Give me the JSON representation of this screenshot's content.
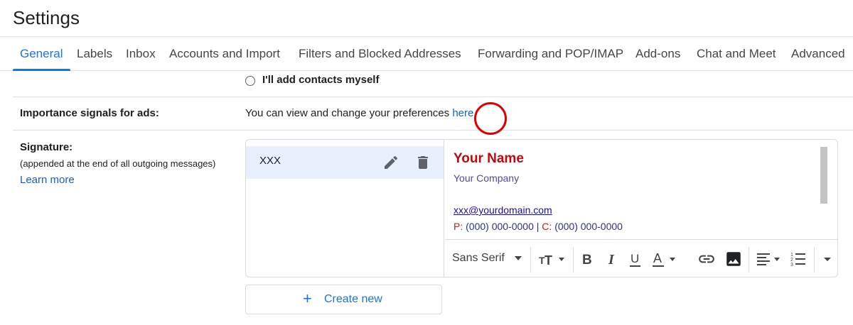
{
  "header": {
    "title": "Settings"
  },
  "tabs": [
    {
      "label": "General",
      "active": true
    },
    {
      "label": "Labels"
    },
    {
      "label": "Inbox"
    },
    {
      "label": "Accounts and Import"
    },
    {
      "label": "Filters and Blocked Addresses"
    },
    {
      "label": "Forwarding and POP/IMAP"
    },
    {
      "label": "Add-ons"
    },
    {
      "label": "Chat and Meet"
    },
    {
      "label": "Advanced"
    }
  ],
  "contacts": {
    "option_label": "I'll add contacts myself",
    "selected": false
  },
  "ads": {
    "label": "Importance signals for ads:",
    "text": "You can view and change your preferences ",
    "link": "here",
    "suffix": "."
  },
  "signature": {
    "label": "Signature:",
    "sublabel": "(appended at the end of all outgoing messages)",
    "learn_more": "Learn more",
    "items": [
      {
        "name": "XXX",
        "selected": true
      }
    ],
    "editor": {
      "name": "Your Name",
      "company": "Your Company",
      "email": "xxx@yourdomain.com",
      "phone_p_label": "P:",
      "phone_p": "(000) 000-0000",
      "phone_sep": "|",
      "phone_c_label": "C:",
      "phone_c": "(000) 000-0000"
    },
    "toolbar": {
      "font": "Sans Serif",
      "icons": [
        "text-size-icon",
        "bold-icon",
        "italic-icon",
        "underline-icon",
        "text-color-icon",
        "link-icon",
        "insert-image-icon",
        "align-icon",
        "numbered-list-icon",
        "more-formatting-icon"
      ],
      "highlighted": "insert-image-icon"
    },
    "create_new": "Create new"
  },
  "colors": {
    "accent": "#1a73e8",
    "link": "#1a5fd0",
    "highlight_ring": "#e00000",
    "sig_name": "#c0090f",
    "selected_bg": "#e8f0fe"
  }
}
